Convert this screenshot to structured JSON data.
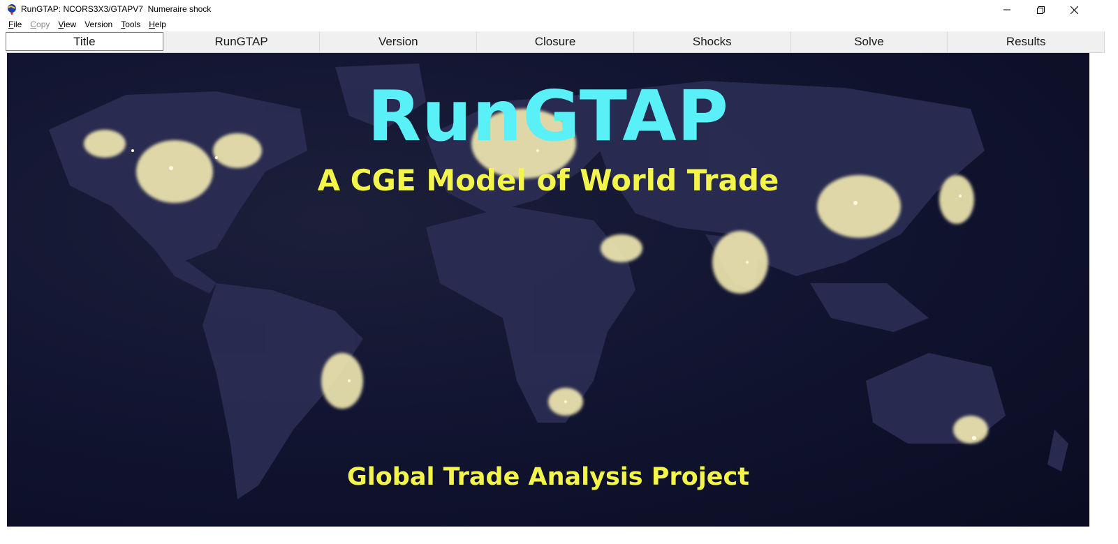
{
  "window": {
    "title": "RunGTAP: NCORS3X3/GTAPV7  Numeraire shock"
  },
  "menu": [
    {
      "label": "File",
      "access": "F",
      "rest": "ile",
      "enabled": true
    },
    {
      "label": "Copy",
      "access": "C",
      "rest": "opy",
      "enabled": false
    },
    {
      "label": "View",
      "access": "V",
      "rest": "iew",
      "enabled": true
    },
    {
      "label": "Version",
      "access": "Ve",
      "rest": "rsion",
      "enabled": true
    },
    {
      "label": "Tools",
      "access": "T",
      "rest": "ools",
      "enabled": true
    },
    {
      "label": "Help",
      "access": "H",
      "rest": "elp",
      "enabled": true
    }
  ],
  "tabs": [
    {
      "label": "Title",
      "active": true
    },
    {
      "label": "RunGTAP",
      "active": false
    },
    {
      "label": "Version",
      "active": false
    },
    {
      "label": "Closure",
      "active": false
    },
    {
      "label": "Shocks",
      "active": false
    },
    {
      "label": "Solve",
      "active": false
    },
    {
      "label": "Results",
      "active": false
    }
  ],
  "hero": {
    "title": "RunGTAP",
    "subtitle": "A CGE Model of World Trade",
    "footer": "Global Trade Analysis Project",
    "title_color": "#59f1f7",
    "text_color": "#f4f54b",
    "background": "night-lights-world-map"
  }
}
